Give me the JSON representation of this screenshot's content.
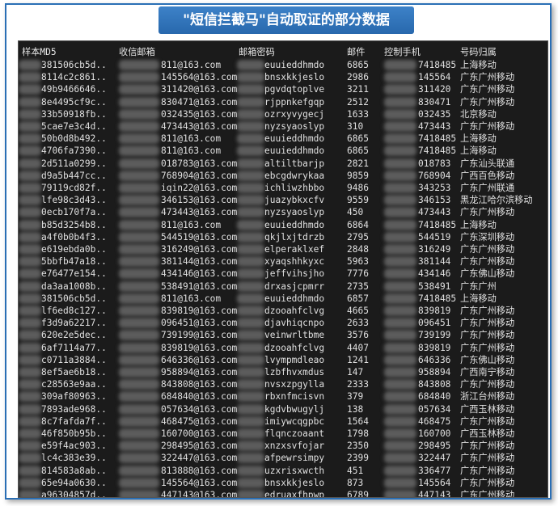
{
  "banner": {
    "title": "\"短信拦截马\"自动取证的部分数据"
  },
  "table": {
    "headers": {
      "md5": "样本MD5",
      "email": "收信邮箱",
      "password": "邮箱密码",
      "count": "邮件",
      "phone": "控制手机",
      "location": "号码归属"
    },
    "rows": [
      {
        "md5": "381506cb5d..",
        "email": "811@163.com",
        "password": "euuieddhmdo",
        "count": "6865",
        "phone": "7418485",
        "location": "上海移动"
      },
      {
        "md5": "8114c2c861..",
        "email": "145564@163.com",
        "password": "bnsxkkjeslo",
        "count": "2986",
        "phone": "145564",
        "location": "广东广州移动"
      },
      {
        "md5": "49b9466646..",
        "email": "311420@163.com",
        "password": "pgvdqtoplve",
        "count": "3211",
        "phone": "311420",
        "location": "广东广州移动"
      },
      {
        "md5": "8e4495cf9c..",
        "email": "830471@163.com",
        "password": "rjppnkefgqp",
        "count": "2512",
        "phone": "830471",
        "location": "广东广州移动"
      },
      {
        "md5": "33b50918fb..",
        "email": "032435@163.com",
        "password": "ozrxyvygecj",
        "count": "1633",
        "phone": "032435",
        "location": "北京移动"
      },
      {
        "md5": "5cae7e3c4d..",
        "email": "473443@163.com",
        "password": "nyzsyaoslyp",
        "count": "310",
        "phone": "473443",
        "location": "广东广州移动"
      },
      {
        "md5": "50b0d8b492..",
        "email": "811@163.com",
        "password": "euuieddhmdo",
        "count": "6865",
        "phone": "7418485",
        "location": "上海移动"
      },
      {
        "md5": "4706fa7390..",
        "email": "811@163.com",
        "password": "euuieddhmdo",
        "count": "6865",
        "phone": "7418485",
        "location": "上海移动"
      },
      {
        "md5": "2d511a0299..",
        "email": "018783@163.com",
        "password": "altiltbarjp",
        "count": "2821",
        "phone": "018783",
        "location": "广东汕头联通"
      },
      {
        "md5": "d9a5b447cc..",
        "email": "768904@163.com",
        "password": "ebcgdwrykaa",
        "count": "9859",
        "phone": "768904",
        "location": "广西百色移动"
      },
      {
        "md5": "79119cd82f..",
        "email": "iqin22@163.com",
        "password": "ichliwzhbbo",
        "count": "9486",
        "phone": "343253",
        "location": "广东广州联通"
      },
      {
        "md5": "lfe98c3d43..",
        "email": "346153@163.com",
        "password": "juazybkxcfv",
        "count": "9559",
        "phone": "346153",
        "location": "黑龙江哈尔滨移动"
      },
      {
        "md5": "0ecb170f7a..",
        "email": "473443@163.com",
        "password": "nyzsyaoslyp",
        "count": "450",
        "phone": "473443",
        "location": "广东广州移动"
      },
      {
        "md5": "b85d3254b8..",
        "email": "811@163.com",
        "password": "euuieddhmdo",
        "count": "6864",
        "phone": "7418485",
        "location": "上海移动"
      },
      {
        "md5": "a4f0b0b4f3..",
        "email": "544519@163.com",
        "password": "qkjlxjtdrzb",
        "count": "2795",
        "phone": "544519",
        "location": "广东深圳移动"
      },
      {
        "md5": "e619ebda0b..",
        "email": "316249@163.com",
        "password": "elperaklxef",
        "count": "2848",
        "phone": "316249",
        "location": "广东广州移动"
      },
      {
        "md5": "5bbfb47a18..",
        "email": "381144@163.com",
        "password": "xyaqshhkyxc",
        "count": "5963",
        "phone": "381144",
        "location": "广东广州移动"
      },
      {
        "md5": "e76477e154..",
        "email": "434146@163.com",
        "password": "jeffvihsjho",
        "count": "7776",
        "phone": "434146",
        "location": "广东佛山移动"
      },
      {
        "md5": "da3aa1008b..",
        "email": "538491@163.com",
        "password": "drxasjcpmrr",
        "count": "2735",
        "phone": "538491",
        "location": "广东广州"
      },
      {
        "md5": "381506cb5d..",
        "email": "811@163.com",
        "password": "euuieddhmdo",
        "count": "6857",
        "phone": "7418485",
        "location": "上海移动"
      },
      {
        "md5": "lf6ed8c127..",
        "email": "839819@163.com",
        "password": "dzooahfclvg",
        "count": "4665",
        "phone": "839819",
        "location": "广东广州移动"
      },
      {
        "md5": "f3d9a62217..",
        "email": "096451@163.com",
        "password": "djavhiqcnpo",
        "count": "2633",
        "phone": "096451",
        "location": "广东广州移动"
      },
      {
        "md5": "620e2e5dec..",
        "email": "739199@163.com",
        "password": "veinwrltbme",
        "count": "3576",
        "phone": "739199",
        "location": "广东广州移动"
      },
      {
        "md5": "6af7114a77..",
        "email": "839819@163.com",
        "password": "dzooahfclvg",
        "count": "4407",
        "phone": "839819",
        "location": "广东广州移动"
      },
      {
        "md5": "c0711a3884..",
        "email": "646336@163.com",
        "password": "lvympmdleao",
        "count": "1241",
        "phone": "646336",
        "location": "广东佛山移动"
      },
      {
        "md5": "8ef5ae6b18..",
        "email": "958894@163.com",
        "password": "lzbfhvxmdus",
        "count": "147",
        "phone": "958894",
        "location": "广西南宁移动"
      },
      {
        "md5": "c28563e9aa..",
        "email": "843808@163.com",
        "password": "nvsxzpgylla",
        "count": "2333",
        "phone": "843808",
        "location": "广东广州移动"
      },
      {
        "md5": "309af80963..",
        "email": "684840@163.com",
        "password": "rbxnfmcisvn",
        "count": "379",
        "phone": "684840",
        "location": "浙江台州移动"
      },
      {
        "md5": "7893ade968..",
        "email": "057634@163.com",
        "password": "kgdvbwugylj",
        "count": "138",
        "phone": "057634",
        "location": "广西玉林移动"
      },
      {
        "md5": "8c7fafda7f..",
        "email": "468475@163.com",
        "password": "imiywcqgpbc",
        "count": "1564",
        "phone": "468475",
        "location": "广东广州移动"
      },
      {
        "md5": "46f850b95b..",
        "email": "160700@163.com",
        "password": "flqnczoaant",
        "count": "1798",
        "phone": "160700",
        "location": "广西玉林移动"
      },
      {
        "md5": "e59f4ac903..",
        "email": "298495@163.com",
        "password": "xnzxsvfojar",
        "count": "2350",
        "phone": "298495",
        "location": "广东广州移动"
      },
      {
        "md5": "lc4c383e39..",
        "email": "322447@163.com",
        "password": "afpewrsimpy",
        "count": "2399",
        "phone": "322447",
        "location": "广东广州移动"
      },
      {
        "md5": "814583a8ab..",
        "email": "813888@163.com",
        "password": "uzxrisxwcth",
        "count": "451",
        "phone": "336477",
        "location": "广东广州移动"
      },
      {
        "md5": "65e94a0630..",
        "email": "145564@163.com",
        "password": "bnsxkkjeslo",
        "count": "873",
        "phone": "145564",
        "location": "广东广州移动"
      },
      {
        "md5": "a96304857d..",
        "email": "447143@163.com",
        "password": "edruaxfhpwp",
        "count": "6789",
        "phone": "447143",
        "location": "广东广州移动"
      }
    ]
  }
}
